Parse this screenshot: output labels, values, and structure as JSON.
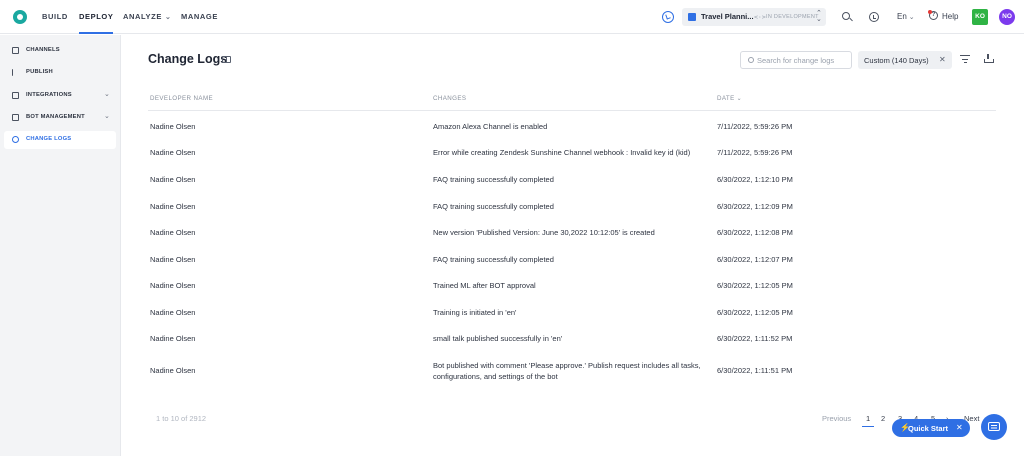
{
  "topnav": {
    "tabs": [
      {
        "label": "BUILD"
      },
      {
        "label": "DEPLOY"
      },
      {
        "label": "ANALYZE"
      },
      {
        "label": "MANAGE"
      }
    ],
    "bot": {
      "name": "Travel Planni...",
      "code_icon": "<·>",
      "status": "IN DEVELOPMENT"
    },
    "language": "En",
    "help_label": "Help",
    "avatars": [
      "KO",
      "NO"
    ]
  },
  "sidebar": {
    "items": [
      {
        "label": "CHANNELS",
        "icon": "channels-icon"
      },
      {
        "label": "PUBLISH",
        "icon": "flag-icon"
      },
      {
        "label": "INTEGRATIONS",
        "icon": "integrations-icon"
      },
      {
        "label": "BOT MANAGEMENT",
        "icon": "bot-management-icon"
      },
      {
        "label": "CHANGE LOGS",
        "icon": "clock-icon"
      }
    ]
  },
  "page": {
    "title": "Change Logs",
    "search_placeholder": "Search for change logs",
    "range_label": "Custom (140 Days)"
  },
  "table": {
    "columns": [
      "DEVELOPER NAME",
      "CHANGES",
      "DATE"
    ],
    "rows": [
      {
        "developer": "Nadine Olsen",
        "change": "Amazon Alexa Channel is enabled",
        "date": "7/11/2022, 5:59:26 PM"
      },
      {
        "developer": "Nadine Olsen",
        "change": "Error while creating Zendesk Sunshine Channel webhook : Invalid key id (kid)",
        "date": "7/11/2022, 5:59:26 PM"
      },
      {
        "developer": "Nadine Olsen",
        "change": "FAQ training successfully completed",
        "date": "6/30/2022, 1:12:10 PM"
      },
      {
        "developer": "Nadine Olsen",
        "change": "FAQ training successfully completed",
        "date": "6/30/2022, 1:12:09 PM"
      },
      {
        "developer": "Nadine Olsen",
        "change": "New version 'Published Version: June 30,2022 10:12:05' is created",
        "date": "6/30/2022, 1:12:08 PM"
      },
      {
        "developer": "Nadine Olsen",
        "change": "FAQ training successfully completed",
        "date": "6/30/2022, 1:12:07 PM"
      },
      {
        "developer": "Nadine Olsen",
        "change": "Trained ML after BOT approval",
        "date": "6/30/2022, 1:12:05 PM"
      },
      {
        "developer": "Nadine Olsen",
        "change": "Training is initiated in 'en'",
        "date": "6/30/2022, 1:12:05 PM"
      },
      {
        "developer": "Nadine Olsen",
        "change": "small talk published successfully in 'en'",
        "date": "6/30/2022, 1:11:52 PM"
      },
      {
        "developer": "Nadine Olsen",
        "change": "Bot published with comment 'Please approve.' Publish request includes all tasks, configurations, and settings of the bot",
        "date": "6/30/2022, 1:11:51 PM"
      }
    ]
  },
  "footer": {
    "count": "1 to 10 of 2912",
    "previous": "Previous",
    "pages": [
      "1",
      "2",
      "3",
      "4",
      "5"
    ],
    "next": "Next",
    "quick_start": "Quick Start"
  },
  "colors": {
    "accent": "#2f6fe4",
    "logo": "#1aa8a0",
    "avatar_ko": "#2fb344",
    "avatar_no": "#7c3aed"
  }
}
